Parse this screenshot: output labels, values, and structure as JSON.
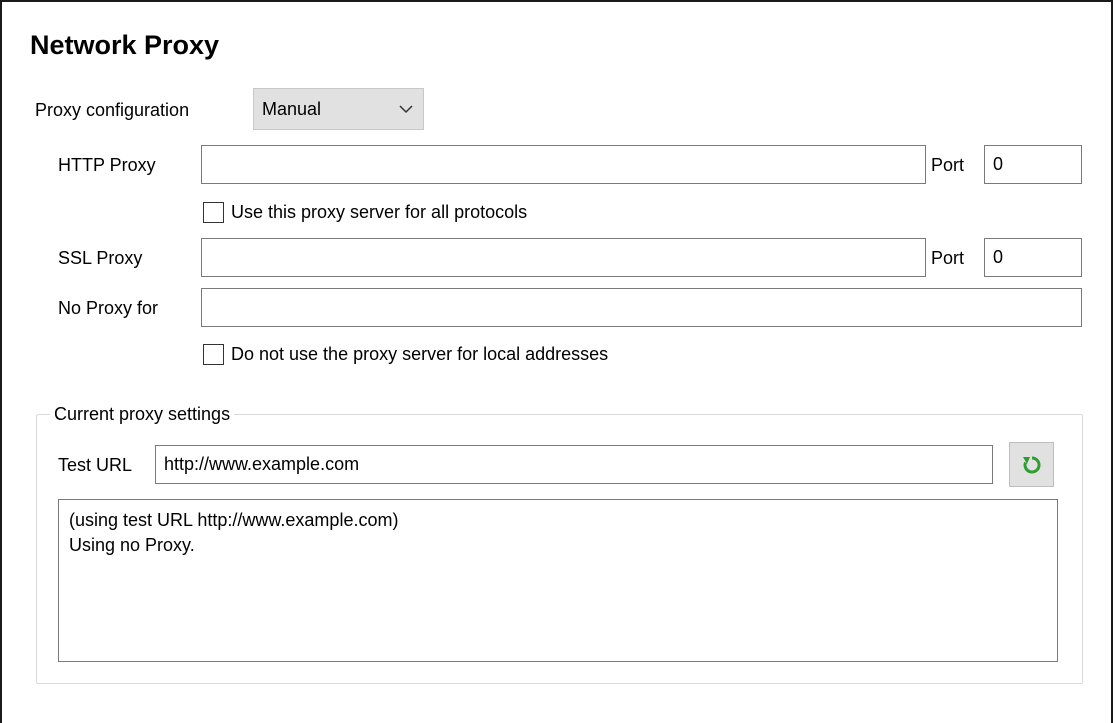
{
  "page": {
    "title": "Network Proxy"
  },
  "proxy_configuration": {
    "label": "Proxy configuration",
    "selected": "Manual",
    "icon": "chevron-down-icon"
  },
  "http_proxy": {
    "label": "HTTP Proxy",
    "value": "",
    "port_label": "Port",
    "port_value": "0"
  },
  "use_for_all_protocols": {
    "label": "Use this proxy server for all protocols",
    "checked": false
  },
  "ssl_proxy": {
    "label": "SSL Proxy",
    "value": "",
    "port_label": "Port",
    "port_value": "0"
  },
  "no_proxy": {
    "label": "No Proxy for",
    "value": ""
  },
  "no_local": {
    "label": "Do not use the proxy server for local addresses",
    "checked": false
  },
  "current_settings": {
    "legend": "Current proxy settings",
    "test_url_label": "Test URL",
    "test_url_value": "http://www.example.com",
    "refresh_icon": "refresh-icon",
    "refresh_color": "#2e9e2e",
    "result_lines": [
      "(using test URL http://www.example.com)",
      "Using no Proxy."
    ]
  }
}
